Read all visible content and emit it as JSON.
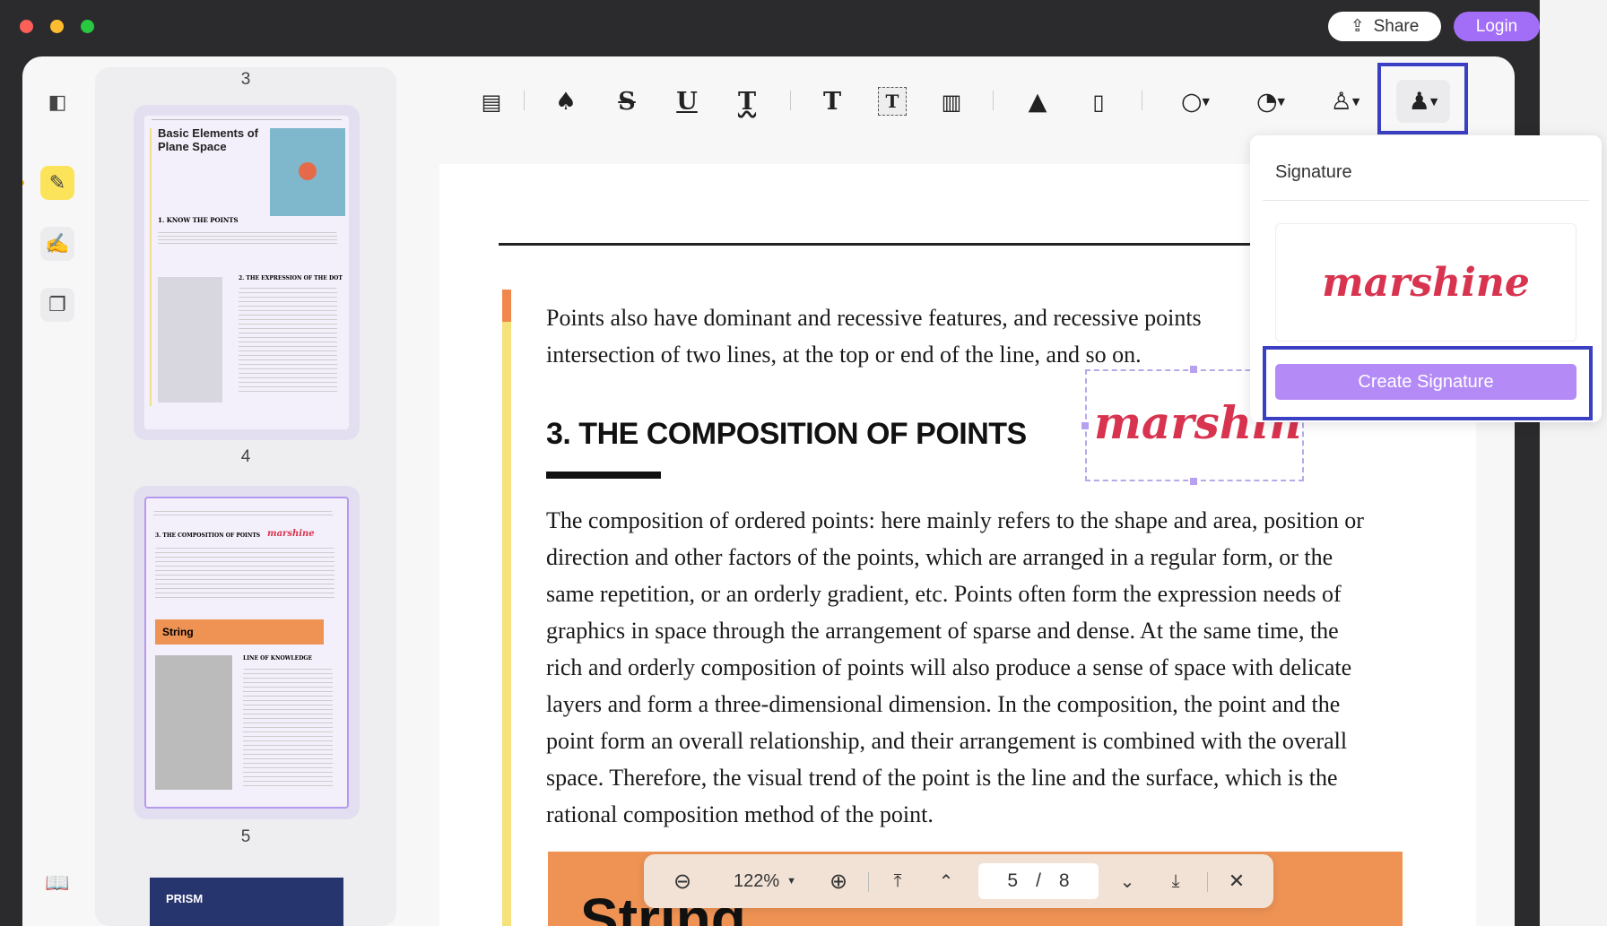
{
  "window": {
    "share_label": "Share",
    "login_label": "Login",
    "accent": "#a36ef7"
  },
  "thumbnails": {
    "labels": [
      "3",
      "4",
      "5"
    ],
    "page4": {
      "title": "Basic Elements of Plane Space",
      "h1": "1. KNOW THE POINTS",
      "h2": "2. THE EXPRESSION OF THE DOT"
    },
    "page5": {
      "h1": "3. THE COMPOSITION OF POINTS",
      "sig": "marshine",
      "block": "String",
      "h2": "LINE OF KNOWLEDGE"
    },
    "page6": {
      "title": "PRISM"
    }
  },
  "document": {
    "intro_lines": [
      "Points also have dominant and recessive features, and recessive points",
      "intersection of two lines, at the top or end of the line, and so on."
    ],
    "heading": "3. THE COMPOSITION OF POINTS",
    "signature": "marshine",
    "body_lines": [
      "The composition of ordered points: here mainly refers to the shape and area, position or",
      "direction and other factors of the points, which are arranged in a regular form, or the",
      "same repetition, or an orderly gradient, etc. Points often form the expression needs of",
      "graphics in space through the arrangement of sparse and dense. At the same time, the",
      "rich and orderly composition of points will also produce a sense of space with delicate",
      "layers and form a three-dimensional dimension. In the composition, the point and the",
      "point form an overall relationship, and their arrangement is combined with the overall",
      "space. Therefore, the visual trend of the point is the line and the surface, which is the",
      "rational composition method of the point."
    ],
    "block_title": "String"
  },
  "popover": {
    "title": "Signature",
    "saved_signature": "marshine",
    "create_label": "Create Signature"
  },
  "navbar": {
    "zoom": "122%",
    "current_page": "5",
    "separator": "/",
    "total_pages": "8"
  }
}
